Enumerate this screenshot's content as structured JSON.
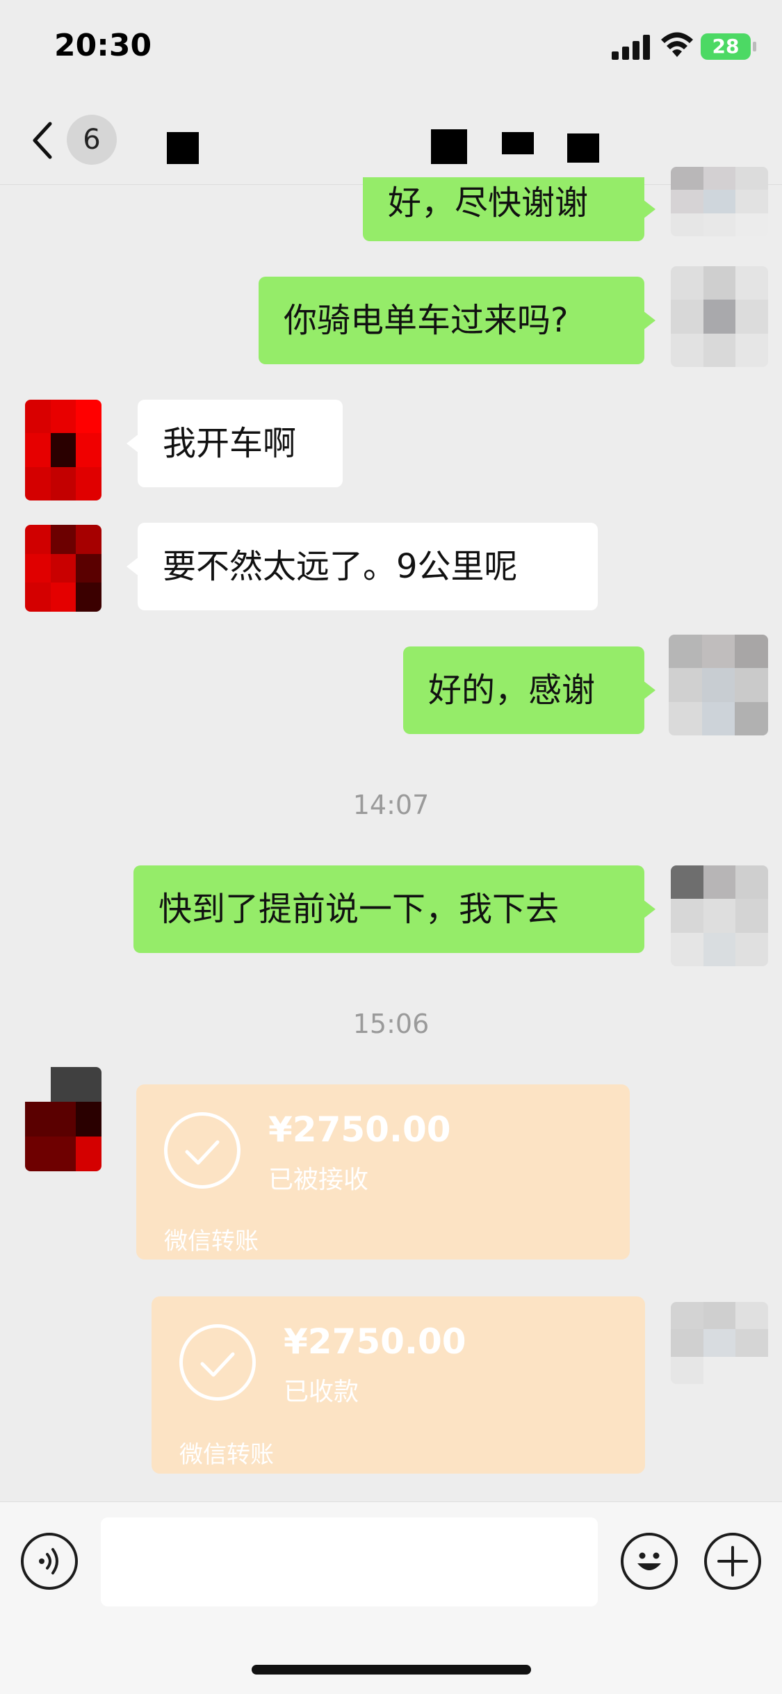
{
  "status_bar": {
    "time": "20:30",
    "battery": "28"
  },
  "nav": {
    "unread_count": "6"
  },
  "messages": [
    {
      "side": "me",
      "text": "好，尽快谢谢"
    },
    {
      "side": "me",
      "text": "你骑电单车过来吗?"
    },
    {
      "side": "other",
      "text": "我开车啊"
    },
    {
      "side": "other",
      "text": "要不然太远了。9公里呢"
    },
    {
      "side": "me",
      "text": "好的，感谢"
    },
    {
      "side": "me",
      "text": "快到了提前说一下，我下去"
    }
  ],
  "time_separators": [
    "14:07",
    "15:06"
  ],
  "transfers": [
    {
      "side": "other",
      "amount": "¥2750.00",
      "state": "已被接收",
      "label": "微信转账"
    },
    {
      "side": "me",
      "amount": "¥2750.00",
      "state": "已收款",
      "label": "微信转账"
    }
  ],
  "icons": {
    "back": "chevron-left-icon",
    "voice": "voice-icon",
    "emoji": "emoji-icon",
    "plus": "plus-icon"
  },
  "colors": {
    "my_bubble": "#95ec69",
    "other_bubble": "#ffffff",
    "transfer": "#fce3c4",
    "background": "#ededed"
  }
}
